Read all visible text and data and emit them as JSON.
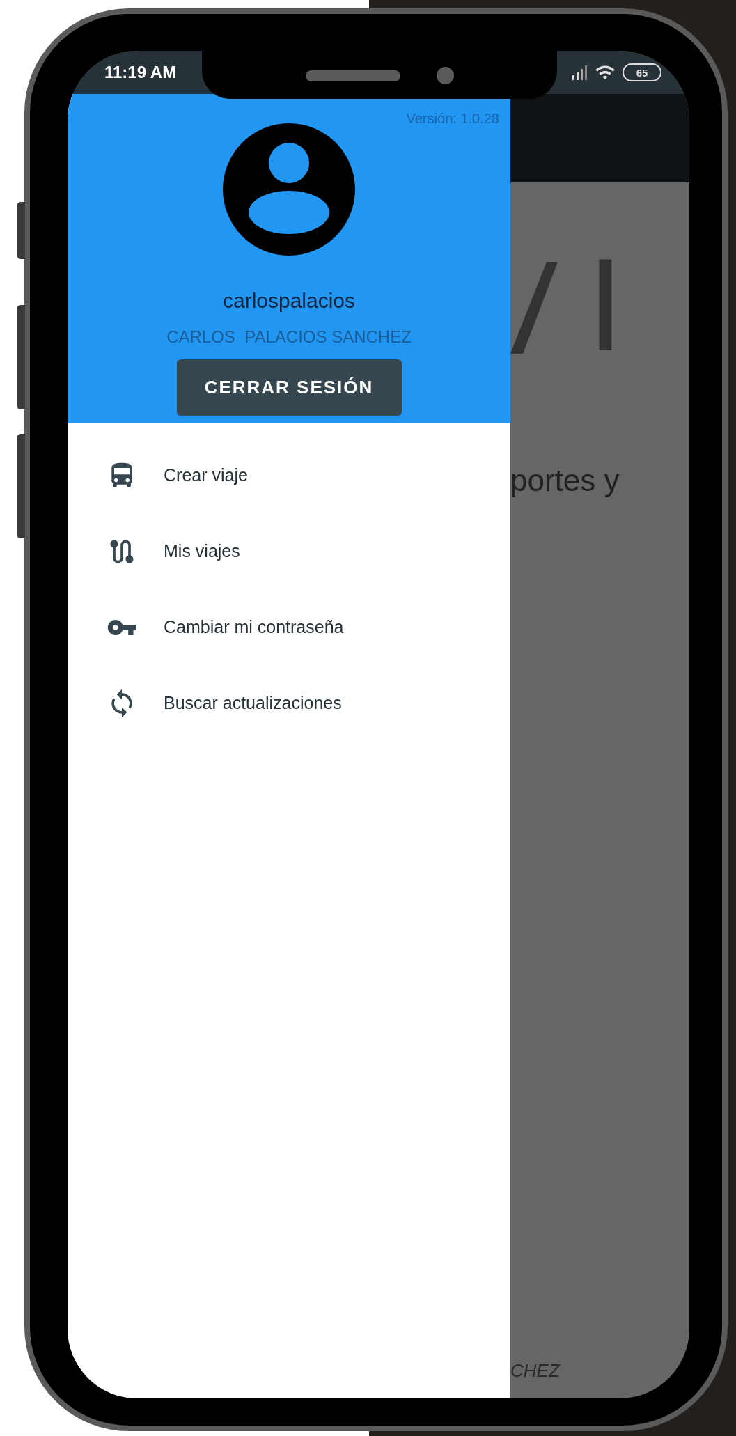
{
  "status_bar": {
    "time": "11:19 AM",
    "battery": "65"
  },
  "drawer": {
    "version": "Versión: 1.0.28",
    "username": "carlospalacios",
    "full_name": "CARLOS  PALACIOS SANCHEZ",
    "logout_button": "CERRAR SESIÓN",
    "items": [
      {
        "label": "Crear viaje"
      },
      {
        "label": "Mis viajes"
      },
      {
        "label": "Cambiar mi contraseña"
      },
      {
        "label": "Buscar actualizaciones"
      }
    ]
  },
  "background_screen": {
    "logo_fragment": "I",
    "text_fragment": "portes y",
    "footer_fragment": "CHEZ"
  }
}
